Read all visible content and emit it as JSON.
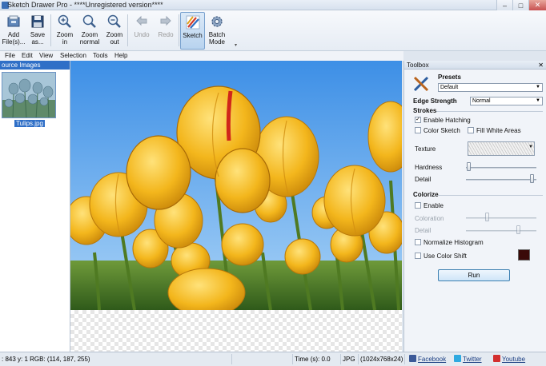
{
  "window": {
    "title": "Sketch Drawer Pro - ****Unregistered version****",
    "minimize": "–",
    "maximize": "□",
    "close": "✕"
  },
  "toolbar": {
    "add_files": "Add\nFile(s)...",
    "add_files_l1": "Add",
    "add_files_l2": "File(s)...",
    "save_as_l1": "Save",
    "save_as_l2": "as...",
    "zoom_in_l1": "Zoom",
    "zoom_in_l2": "in",
    "zoom_normal_l1": "Zoom",
    "zoom_normal_l2": "normal",
    "zoom_out_l1": "Zoom",
    "zoom_out_l2": "out",
    "undo": "Undo",
    "redo": "Redo",
    "sketch": "Sketch",
    "batch_mode_l1": "Batch",
    "batch_mode_l2": "Mode"
  },
  "menu": [
    "File",
    "Edit",
    "View",
    "Selection",
    "Tools",
    "Help"
  ],
  "source_panel": {
    "header": "ource Images",
    "items": [
      {
        "label": "Tulips.jpg"
      }
    ]
  },
  "toolbox": {
    "title": "Toolbox",
    "close": "✕",
    "presets_label": "Presets",
    "presets_value": "Default",
    "edge_strength_label": "Edge Strength",
    "edge_strength_value": "Normal",
    "strokes_label": "Strokes",
    "enable_hatching": "Enable Hatching",
    "enable_hatching_checked": "✓",
    "color_sketch": "Color Sketch",
    "fill_white_areas": "Fill White Areas",
    "texture_label": "Texture",
    "hardness_label": "Hardness",
    "detail_label": "Detail",
    "colorize_label": "Colorize",
    "enable_colorize": "Enable",
    "coloration_label": "Coloration",
    "colorize_detail_label": "Detail",
    "normalize_histogram": "Normalize Histogram",
    "use_color_shift": "Use Color Shift",
    "color_shift_color": "#3a0a08",
    "run": "Run"
  },
  "status": {
    "coords": ": 843 y: 1  RGB: (114, 187, 255)",
    "time": "Time (s):  0.0",
    "format": "JPG",
    "dimensions": "(1024x768x24)",
    "facebook": "Facebook",
    "twitter": "Twitter",
    "youtube": "Youtube"
  },
  "colors": {
    "accent": "#2f6fc7",
    "sky": "#72bbff",
    "tulip": "#f2b81d"
  }
}
